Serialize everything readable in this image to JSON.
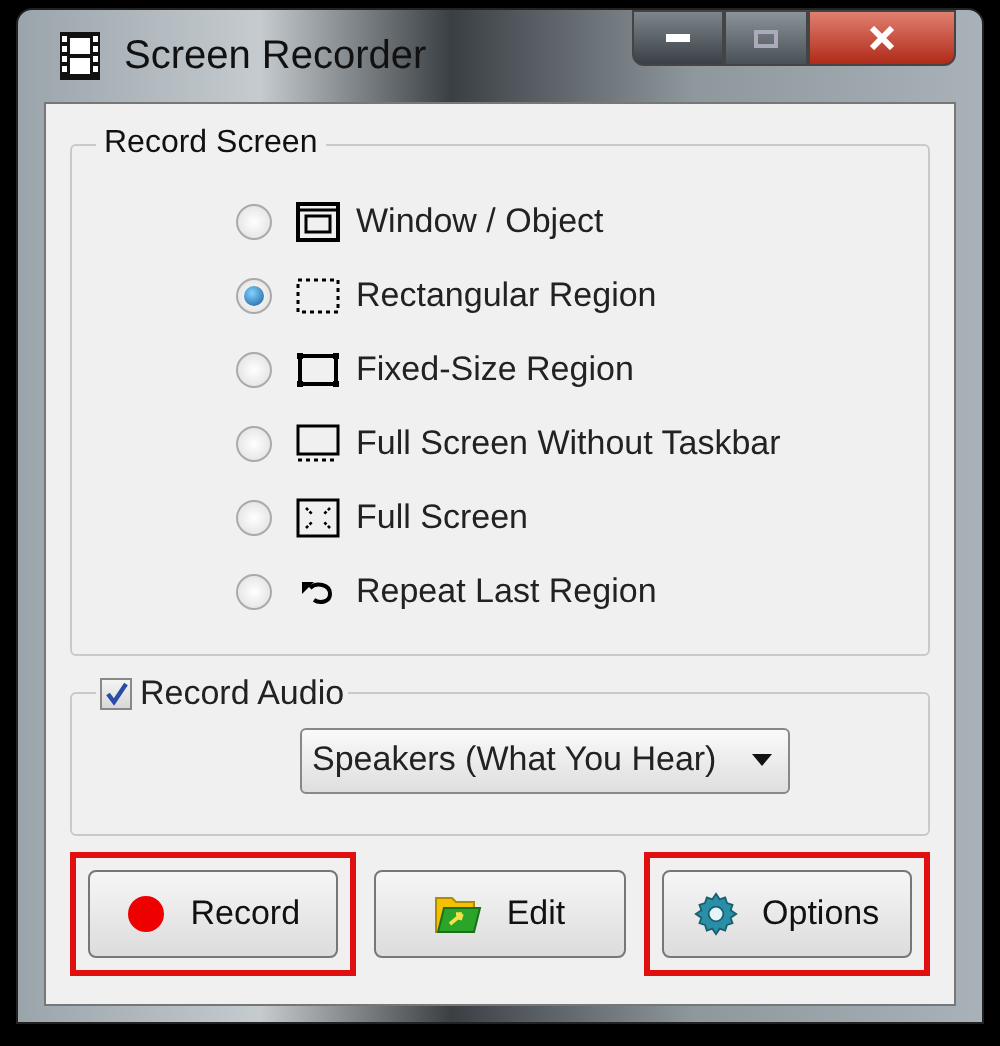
{
  "window": {
    "title": "Screen Recorder"
  },
  "record_screen": {
    "title": "Record Screen",
    "options": [
      {
        "label": "Window / Object",
        "kind": "window",
        "selected": false
      },
      {
        "label": "Rectangular Region",
        "kind": "dashed",
        "selected": true
      },
      {
        "label": "Fixed-Size Region",
        "kind": "fixed",
        "selected": false
      },
      {
        "label": "Full Screen Without Taskbar",
        "kind": "taskbar",
        "selected": false
      },
      {
        "label": "Full Screen",
        "kind": "full",
        "selected": false
      },
      {
        "label": "Repeat Last Region",
        "kind": "repeat",
        "selected": false
      }
    ]
  },
  "record_audio": {
    "label": "Record Audio",
    "checked": true,
    "device": "Speakers (What You Hear)"
  },
  "buttons": [
    {
      "label": "Record",
      "kind": "record",
      "highlighted": true
    },
    {
      "label": "Edit",
      "kind": "edit",
      "highlighted": false
    },
    {
      "label": "Options",
      "kind": "gear",
      "highlighted": true
    }
  ]
}
